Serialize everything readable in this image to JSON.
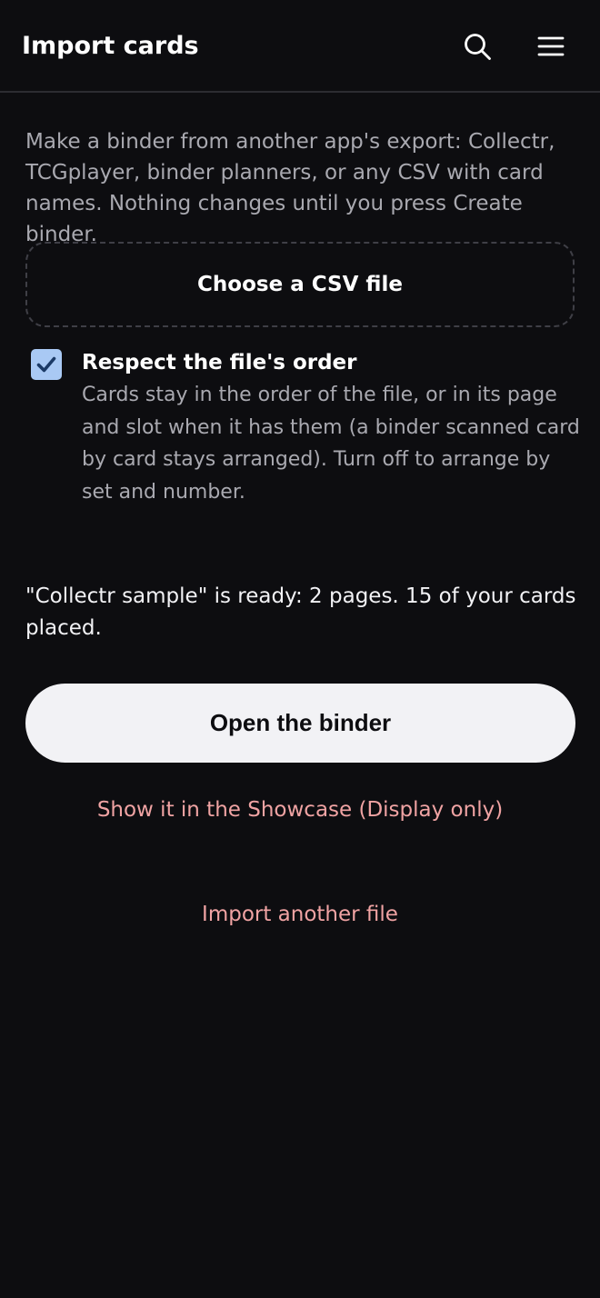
{
  "header": {
    "title": "Import cards",
    "search_icon": "search-icon",
    "menu_icon": "hamburger-menu-icon"
  },
  "intro": {
    "text": "Make a binder from another app's export: Collectr, TCGplayer, binder planners, or any CSV with card names. Nothing changes until you press Create binder."
  },
  "file_picker": {
    "label": "Choose a CSV file"
  },
  "order_option": {
    "checked": true,
    "title": "Respect the file's order",
    "description": "Cards stay in the order of the file, or in its page and slot when it has them (a binder scanned card by card stays arranged). Turn off to arrange by set and number."
  },
  "status": {
    "message": "\"Collectr sample\" is ready: 2 pages. 15 of your cards placed."
  },
  "actions": {
    "open_binder_label": "Open the binder",
    "showcase_label": "Show it in the Showcase (Display only)",
    "import_another_label": "Import another file"
  },
  "colors": {
    "background": "#0d0d10",
    "text_primary": "#f2f2f5",
    "text_muted": "#a9a9b0",
    "link": "#f0a3a3",
    "checkbox": "#a9c9f4",
    "button_bg": "#f2f2f5"
  }
}
